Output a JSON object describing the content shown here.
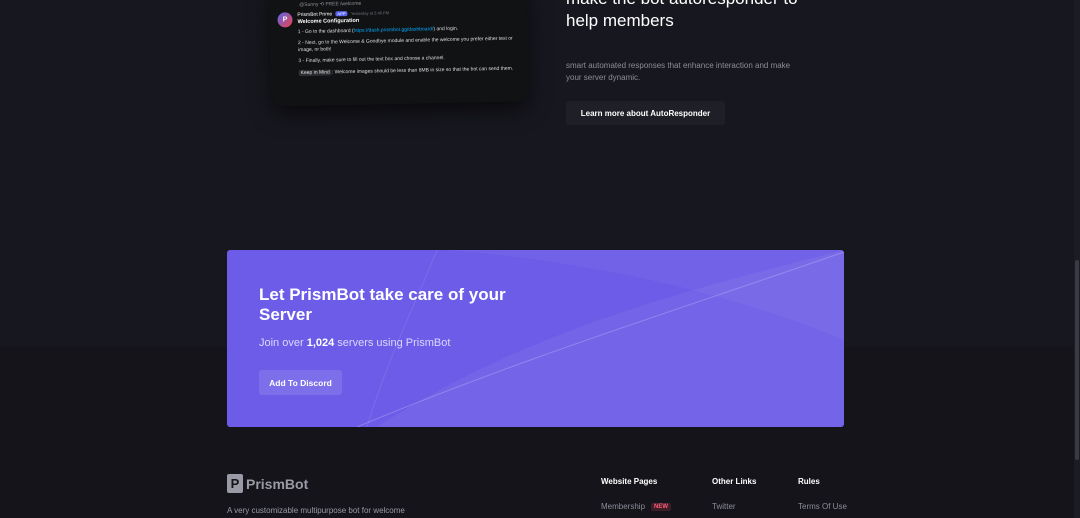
{
  "discord_preview": {
    "reference": "@Sunny  ⟲ FREE  /welcome",
    "bot_name": "PrismBot Prime",
    "app_badge": "APP",
    "timestamp": "Yesterday at 2:46 PM",
    "title": "Welcome Configuration",
    "step1_text": "1 - Go to the dashboard (",
    "step1_link": "https://dash.prismbot.gg/dashboard/",
    "step1_end": ") and login.",
    "step2_text": "2 - Next, go to the Welcome & Goodbye module and enable the welcome you prefer either text or image, or both!",
    "step3_text": "3 - Finally, make sure to fill out the text box and choose a channel.",
    "keep_in_mind": "Keep in Mind",
    "keep_text": ": Welcome images should be less than 8MB in size so that the bot can send them."
  },
  "autoresponder": {
    "heading": "make the bot autoresponder to help members",
    "description": "smart automated responses that enhance interaction and make your server dynamic.",
    "button_label": "Learn more about AutoResponder"
  },
  "cta": {
    "title": "Let PrismBot take care of your Server",
    "subtitle_prefix": "Join over ",
    "server_count": "1,024",
    "subtitle_suffix": " servers using PrismBot",
    "button_label": "Add To Discord"
  },
  "footer": {
    "logo_mark": "P",
    "logo_text": "PrismBot",
    "tagline": "A very customizable multipurpose bot for welcome",
    "columns": [
      {
        "title": "Website Pages",
        "link": "Membership",
        "badge": "NEW"
      },
      {
        "title": "Other Links",
        "link": "Twitter"
      },
      {
        "title": "Rules",
        "link": "Terms Of Use"
      }
    ]
  },
  "colors": {
    "page_bg": "#17171f",
    "footer_bg": "#14141a",
    "cta_bg": "#6c5ce7",
    "accent_new": "#ff5c7a",
    "discord_link": "#00a8fc"
  }
}
